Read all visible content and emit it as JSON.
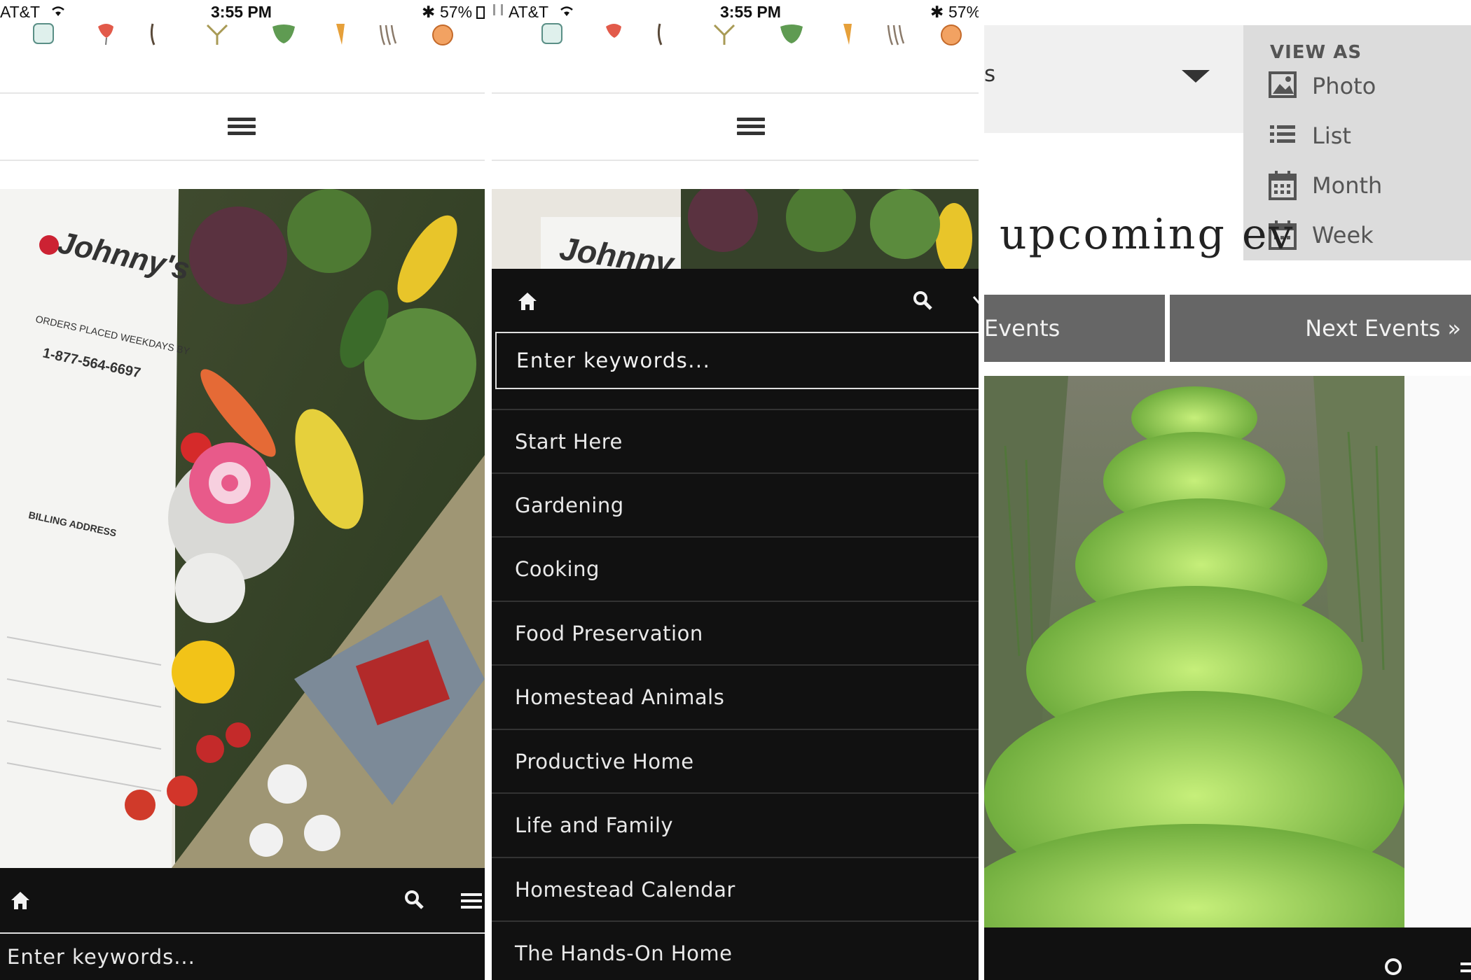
{
  "colors": {
    "dark_bar": "#111111",
    "panel_grey": "#dcdcdc",
    "button_grey": "#666666",
    "text_light": "#e9e9e9"
  },
  "screens": [
    {
      "status": {
        "carrier": "AT&T",
        "time": "3:55 PM",
        "battery": "57%"
      },
      "bottom_bar": {
        "home_icon": "home-icon",
        "search_icon": "search-icon",
        "menu_icon": "hamburger-menu-icon"
      },
      "search_placeholder": "Enter keywords..."
    },
    {
      "status": {
        "carrier": "AT&T",
        "time": "3:55 PM",
        "battery": "57%"
      },
      "search_placeholder": "Enter keywords...",
      "menu_items": [
        "Start Here",
        "Gardening",
        "Cooking",
        "Food Preservation",
        "Homestead Animals",
        "Productive Home",
        "Life and Family",
        "Homestead Calendar",
        "The Hands-On Home"
      ]
    },
    {
      "select_fragment": "s",
      "view_as": {
        "title": "VIEW AS",
        "options": [
          {
            "label": "Photo",
            "icon": "photo-icon"
          },
          {
            "label": "List",
            "icon": "list-icon"
          },
          {
            "label": "Month",
            "icon": "calendar-icon"
          },
          {
            "label": "Week",
            "icon": "calendar-icon"
          }
        ]
      },
      "heading": "upcoming ev",
      "prev_events": "Events",
      "next_events": "Next Events »"
    }
  ]
}
